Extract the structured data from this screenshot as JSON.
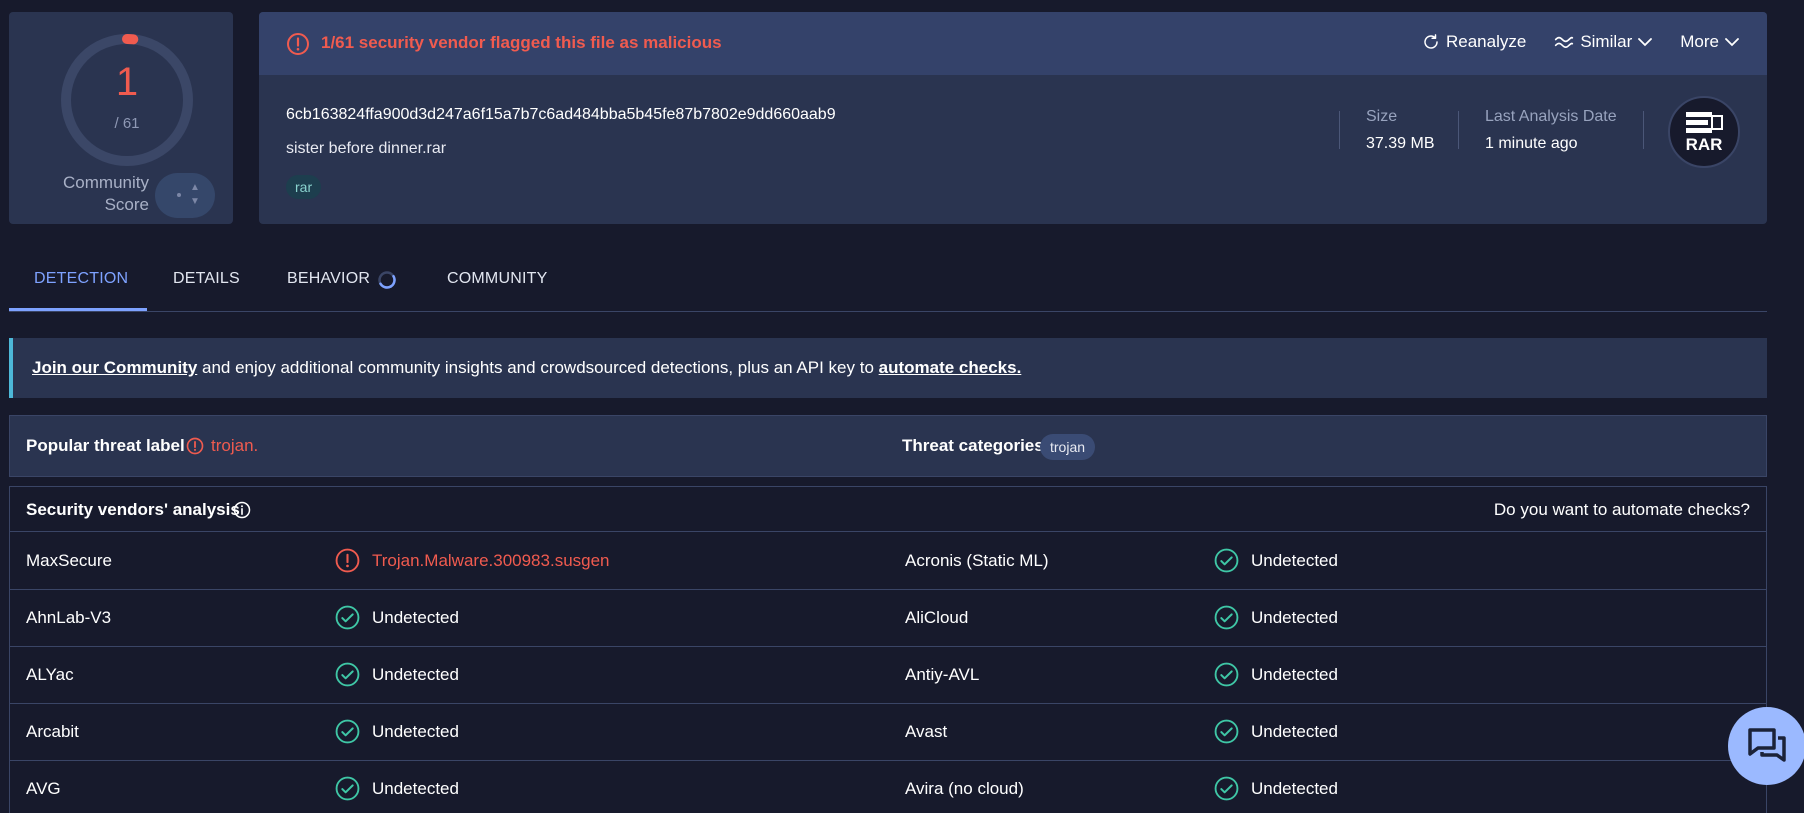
{
  "score": {
    "value": "1",
    "total": "/ 61",
    "fraction_flagged": 0.0164,
    "community_label": "Community Score"
  },
  "alert": {
    "text": "1/61 security vendor flagged this file as malicious",
    "actions": {
      "reanalyze": "Reanalyze",
      "similar": "Similar",
      "more": "More"
    }
  },
  "file": {
    "hash": "6cb163824ffa900d3d247a6f15a7b7c6ad484bba5b45fe87b7802e9dd660aab9",
    "name": "sister before dinner.rar",
    "tag": "rar",
    "size_label": "Size",
    "size_value": "37.39 MB",
    "date_label": "Last Analysis Date",
    "date_value": "1 minute ago",
    "type_badge": "RAR"
  },
  "tabs": {
    "detection": "DETECTION",
    "details": "DETAILS",
    "behavior": "BEHAVIOR",
    "community": "COMMUNITY"
  },
  "banner": {
    "link1": "Join our Community",
    "middle": " and enjoy additional community insights and crowdsourced detections, plus an API key to ",
    "link2": "automate checks."
  },
  "threat": {
    "label": "Popular threat label",
    "value": "trojan.",
    "categories_label": "Threat categories",
    "category": "trojan"
  },
  "vendors": {
    "title": "Security vendors' analysis",
    "automate": "Do you want to automate checks?",
    "rows": [
      {
        "left_name": "MaxSecure",
        "left_result": "Trojan.Malware.300983.susgen",
        "left_status": "malicious",
        "right_name": "Acronis (Static ML)",
        "right_result": "Undetected",
        "right_status": "undetected"
      },
      {
        "left_name": "AhnLab-V3",
        "left_result": "Undetected",
        "left_status": "undetected",
        "right_name": "AliCloud",
        "right_result": "Undetected",
        "right_status": "undetected"
      },
      {
        "left_name": "ALYac",
        "left_result": "Undetected",
        "left_status": "undetected",
        "right_name": "Antiy-AVL",
        "right_result": "Undetected",
        "right_status": "undetected"
      },
      {
        "left_name": "Arcabit",
        "left_result": "Undetected",
        "left_status": "undetected",
        "right_name": "Avast",
        "right_result": "Undetected",
        "right_status": "undetected"
      },
      {
        "left_name": "AVG",
        "left_result": "Undetected",
        "left_status": "undetected",
        "right_name": "Avira (no cloud)",
        "right_result": "Undetected",
        "right_status": "undetected"
      }
    ]
  },
  "colors": {
    "malicious": "#f05b4f",
    "undetected": "#3fc7a6",
    "accent": "#7ea2ff",
    "background": "#171a2c",
    "card": "#2a3450"
  },
  "icons": {
    "alert": "alert-circle-icon",
    "reanalyze": "refresh-icon",
    "similar": "similar-wave-icon",
    "chevron": "chevron-down-icon",
    "check": "check-circle-icon",
    "info": "info-icon",
    "chat": "chat-bubbles-icon",
    "file_type": "rar-archive-icon"
  }
}
